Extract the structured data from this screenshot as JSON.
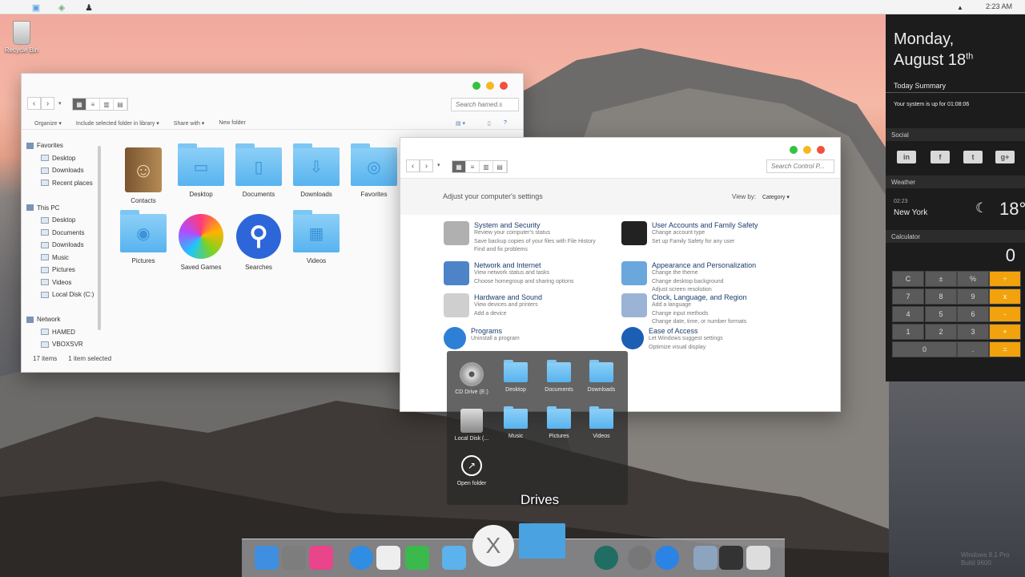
{
  "menubar": {
    "clock": "2:23 AM"
  },
  "desktop": {
    "recycle_label": "Recycle Bin"
  },
  "explorer": {
    "search_placeholder": "Search hamed.s",
    "commands": [
      "Organize ▾",
      "Include selected folder in library ▾",
      "Share with ▾",
      "New folder"
    ],
    "nav": [
      {
        "label": "Favorites",
        "level": 0
      },
      {
        "label": "Desktop",
        "level": 1
      },
      {
        "label": "Downloads",
        "level": 1
      },
      {
        "label": "Recent places",
        "level": 1
      },
      {
        "label": "",
        "level": -1
      },
      {
        "label": "This PC",
        "level": 0
      },
      {
        "label": "Desktop",
        "level": 1
      },
      {
        "label": "Documents",
        "level": 1
      },
      {
        "label": "Downloads",
        "level": 1
      },
      {
        "label": "Music",
        "level": 1
      },
      {
        "label": "Pictures",
        "level": 1
      },
      {
        "label": "Videos",
        "level": 1
      },
      {
        "label": "Local Disk (C:)",
        "level": 1
      },
      {
        "label": "",
        "level": -1
      },
      {
        "label": "Network",
        "level": 0
      },
      {
        "label": "HAMED",
        "level": 1
      },
      {
        "label": "VBOXSVR",
        "level": 1
      }
    ],
    "items": [
      {
        "label": "Contacts",
        "icon": "contacts-icon"
      },
      {
        "label": "Desktop",
        "icon": "desktop-folder-icon"
      },
      {
        "label": "Documents",
        "icon": "documents-folder-icon"
      },
      {
        "label": "Downloads",
        "icon": "downloads-folder-icon"
      },
      {
        "label": "Favorites",
        "icon": "favorites-folder-icon"
      },
      {
        "label": "Pictures",
        "icon": "pictures-folder-icon"
      },
      {
        "label": "Saved Games",
        "icon": "saved-games-icon"
      },
      {
        "label": "Searches",
        "icon": "searches-icon"
      },
      {
        "label": "Videos",
        "icon": "videos-folder-icon"
      }
    ],
    "status": {
      "count": "17 items",
      "selected": "1 item selected"
    }
  },
  "control_panel": {
    "search_placeholder": "Search Control P...",
    "heading": "Adjust your computer's settings",
    "view_by_label": "View by:",
    "view_by_value": "Category ▾",
    "left": [
      {
        "title": "System and Security",
        "links": [
          "Review your computer's status",
          "Save backup copies of your files with File History",
          "Find and fix problems"
        ]
      },
      {
        "title": "Network and Internet",
        "links": [
          "View network status and tasks",
          "Choose homegroup and sharing options"
        ]
      },
      {
        "title": "Hardware and Sound",
        "links": [
          "View devices and printers",
          "Add a device"
        ]
      },
      {
        "title": "Programs",
        "links": [
          "Uninstall a program"
        ]
      }
    ],
    "right": [
      {
        "title": "User Accounts and Family Safety",
        "links": [
          "Change account type",
          "Set up Family Safety for any user"
        ]
      },
      {
        "title": "Appearance and Personalization",
        "links": [
          "Change the theme",
          "Change desktop background",
          "Adjust screen resolution"
        ]
      },
      {
        "title": "Clock, Language, and Region",
        "links": [
          "Add a language",
          "Change input methods",
          "Change date, time, or number formats"
        ]
      },
      {
        "title": "Ease of Access",
        "links": [
          "Let Windows suggest settings",
          "Optimize visual display"
        ]
      }
    ]
  },
  "drives": {
    "title": "Drives",
    "items": [
      {
        "label": "CD Drive (E:)"
      },
      {
        "label": "Desktop"
      },
      {
        "label": "Documents"
      },
      {
        "label": "Downloads"
      },
      {
        "label": "Local Disk (..."
      },
      {
        "label": "Music"
      },
      {
        "label": "Pictures"
      },
      {
        "label": "Videos"
      },
      {
        "label": "Open folder"
      }
    ]
  },
  "side_panel": {
    "date_line1": "Monday,",
    "date_line2": "August 18",
    "date_suffix": "th",
    "today_summary": "Today Summary",
    "uptime": "Your system is up for 01:08:06",
    "social_label": "Social",
    "social": [
      "in",
      "f",
      "t",
      "g+"
    ],
    "weather_label": "Weather",
    "weather_time": "02:23",
    "weather_city": "New York",
    "weather_icon": "☾",
    "weather_temp": "18°",
    "calc_label": "Calculator",
    "calc_display": "0",
    "calc_keys": [
      "C",
      "±",
      "%",
      "÷",
      "7",
      "8",
      "9",
      "x",
      "4",
      "5",
      "6",
      "-",
      "1",
      "2",
      "3",
      "+",
      "0",
      ".",
      "="
    ]
  },
  "dock": {
    "items": [
      "finder-icon",
      "system-preferences-icon",
      "game-center-icon",
      "safari-icon",
      "textedit-icon",
      "facetime-icon",
      "folder-icon",
      "os-x-icon",
      "applications-folder-icon",
      "time-machine-icon",
      "launchpad-icon",
      "app-store-icon",
      "preview-icon",
      "photo-booth-icon",
      "trash-icon"
    ]
  },
  "watermark": {
    "line1": "Windows 8.1 Pro",
    "line2": "Build 9600"
  }
}
